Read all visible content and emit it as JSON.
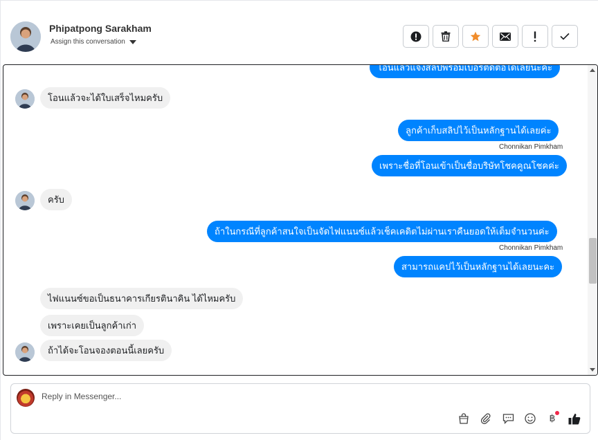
{
  "header": {
    "contact_name": "Phipatpong Sarakham",
    "assign_label": "Assign this conversation",
    "actions": [
      {
        "icon": "alert-circle-icon"
      },
      {
        "icon": "trash-icon"
      },
      {
        "icon": "star-icon",
        "color": "#f08c2a"
      },
      {
        "icon": "envelope-icon"
      },
      {
        "icon": "exclamation-icon"
      },
      {
        "icon": "check-icon"
      }
    ]
  },
  "messages": [
    {
      "dir": "out",
      "text": "โอนแล้วแจ้งสลิปพร้อมเบอร์ติดต่อได้เลยนะคะ"
    },
    {
      "dir": "in",
      "text": "โอนแล้วจะได้ใบเสร็จไหมครับ"
    },
    {
      "dir": "out",
      "text": "ลูกค้าเก็บสลิปไว้เป็นหลักฐานได้เลยค่ะ"
    },
    {
      "dir": "out",
      "text": "เพราะชื่อที่โอนเข้าเป็นชื่อบริษัทโชคคูณโชคค่ะ"
    },
    {
      "dir": "in",
      "text": "ครับ"
    },
    {
      "dir": "out",
      "text": "ถ้าในกรณีที่ลูกค้าสนใจเป็นจัดไฟแนนซ์แล้วเช็คเคดิตไม่ผ่านเราคืนยอดให้เต็มจำนวนค่ะ"
    },
    {
      "dir": "out",
      "text": "สามารถแคปไว้เป็นหลักฐานได้เลยนะคะ"
    },
    {
      "dir": "in",
      "text": "ไฟแนนซ์ขอเป็นธนาคารเกียรตินาคิน ได้ไหมครับ"
    },
    {
      "dir": "in",
      "text": "เพราะเคยเป็นลูกค้าเก่า"
    },
    {
      "dir": "in",
      "text": "ถ้าได้จะโอนจองตอนนี้เลยครับ"
    }
  ],
  "sender_label": "Chonnikan Pimkham",
  "reply": {
    "placeholder": "Reply in Messenger...",
    "tools": [
      "bag-icon",
      "paperclip-icon",
      "speech-bubble-icon",
      "smiley-icon",
      "baht-icon",
      "thumbs-up-icon"
    ],
    "baht_symbol": "฿"
  },
  "colors": {
    "outgoing": "#0084ff",
    "incoming": "#f0f0f0",
    "star": "#f08c2a",
    "notification_dot": "#f02849"
  }
}
